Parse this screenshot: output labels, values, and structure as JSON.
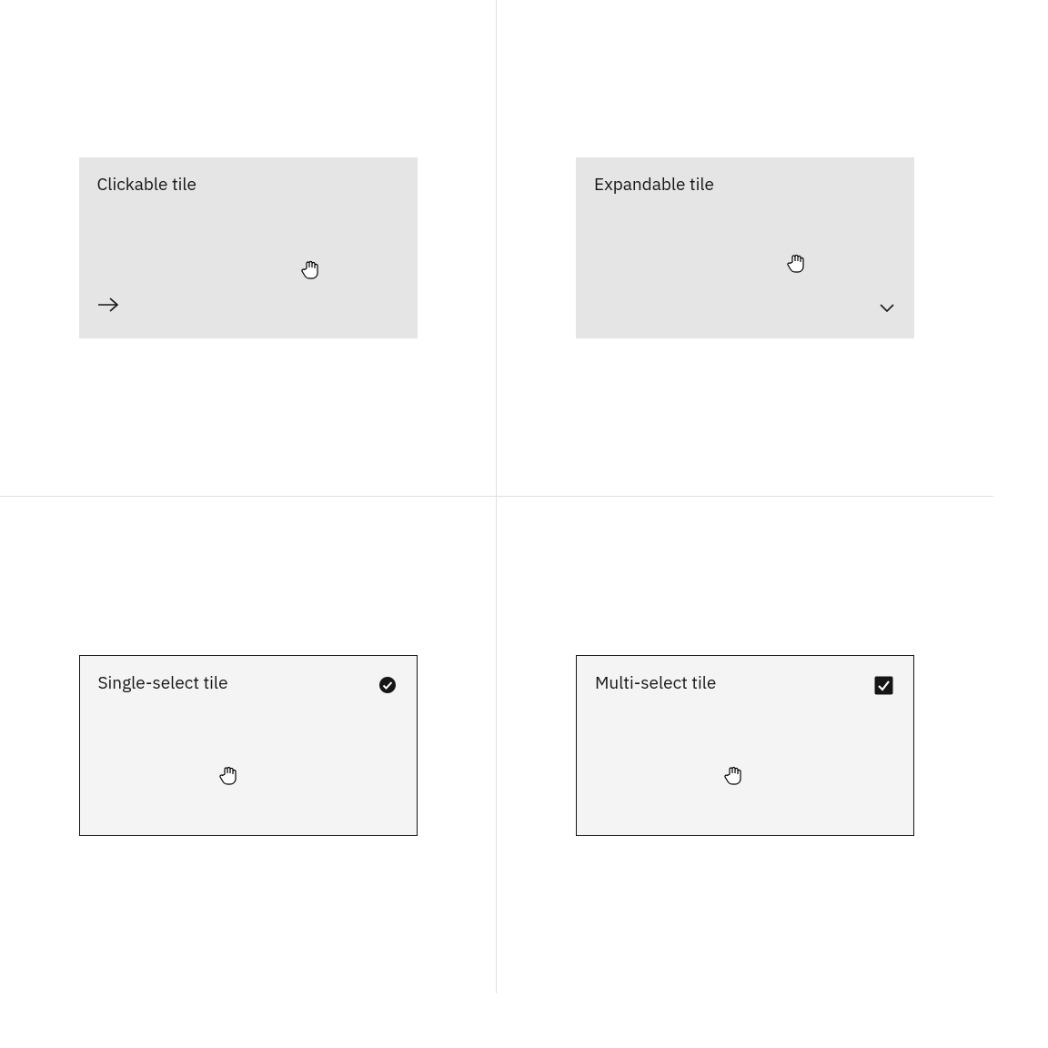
{
  "tiles": {
    "clickable": {
      "title": "Clickable tile"
    },
    "expandable": {
      "title": "Expandable tile"
    },
    "single": {
      "title": "Single-select tile"
    },
    "multi": {
      "title": "Multi-select tile"
    }
  }
}
